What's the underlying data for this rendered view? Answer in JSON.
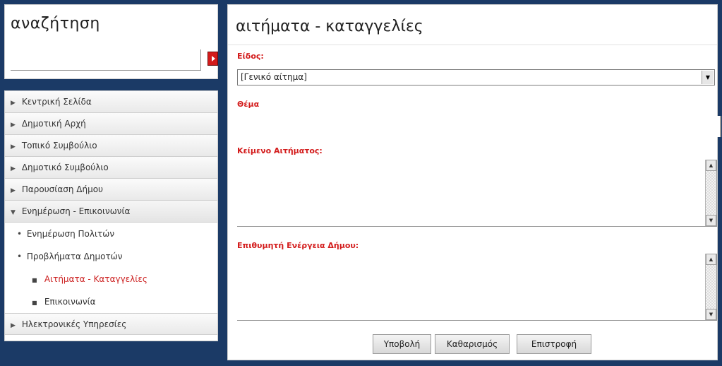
{
  "search": {
    "title": "αναζήτηση",
    "input_value": "",
    "button_icon": "arrow-right-icon"
  },
  "menu": {
    "items": [
      {
        "label": "Κεντρική Σελίδα"
      },
      {
        "label": "Δημοτική Αρχή"
      },
      {
        "label": "Τοπικό Συμβούλιο"
      },
      {
        "label": "Δημοτικό Συμβούλιο"
      },
      {
        "label": "Παρουσίαση Δήμου"
      },
      {
        "label": "Ενημέρωση - Επικοινωνία"
      }
    ],
    "submenu": [
      {
        "label": "Ενημέρωση Πολιτών"
      },
      {
        "label": "Προβλήματα Δημοτών"
      }
    ],
    "subsubmenu": [
      {
        "label": "Αιτήματα - Καταγγελίες"
      },
      {
        "label": "Επικοινωνία"
      }
    ],
    "last_item": {
      "label": "Ηλεκτρονικές Υπηρεσίες"
    }
  },
  "form": {
    "title": "αιτήματα - καταγγελίες",
    "type_label": "Είδος:",
    "type_value": "[Γενικό αίτημα]",
    "subject_label": "Θέμα",
    "subject_value": "",
    "body_label": "Κείμενο Αιτήματος:",
    "body_value": "",
    "action_label": "Επιθυμητή Ενέργεια Δήμου:",
    "action_value": "",
    "buttons": {
      "submit": "Υποβολή",
      "clear": "Καθαρισμός",
      "back": "Επιστροφή"
    }
  },
  "colors": {
    "page_background": "#1b3a66",
    "accent_red": "#d31b1b"
  }
}
